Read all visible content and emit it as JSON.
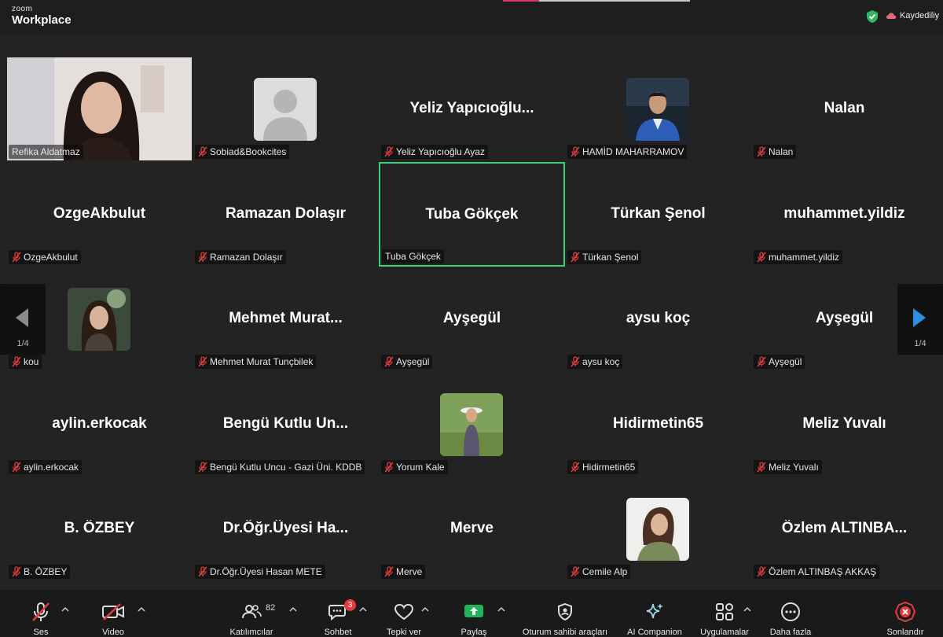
{
  "app": {
    "brand_small": "zoom",
    "brand_large": "Workplace",
    "recording_text": "Kaydediliy"
  },
  "pager": {
    "left_page": "1/4",
    "right_page": "1/4"
  },
  "tiles": [
    {
      "label": "Refika Aldatmaz",
      "big": "",
      "kind": "video",
      "muted": false
    },
    {
      "label": "Sobiad&Bookcites",
      "big": "",
      "kind": "avatar",
      "muted": true
    },
    {
      "label": "Yeliz Yapıcıoğlu  Ayaz",
      "big": "Yeliz  Yapıcıoğlu...",
      "kind": "name",
      "muted": true
    },
    {
      "label": "HAMİD MAHARRAMOV",
      "big": "",
      "kind": "photo-man",
      "muted": true
    },
    {
      "label": "Nalan",
      "big": "Nalan",
      "kind": "name",
      "muted": true
    },
    {
      "label": "OzgeAkbulut",
      "big": "OzgeAkbulut",
      "kind": "name",
      "muted": true
    },
    {
      "label": "Ramazan Dolaşır",
      "big": "Ramazan Dolaşır",
      "kind": "name",
      "muted": true
    },
    {
      "label": "Tuba Gökçek",
      "big": "Tuba Gökçek",
      "kind": "name",
      "muted": false,
      "active": true
    },
    {
      "label": "Türkan Şenol",
      "big": "Türkan Şenol",
      "kind": "name",
      "muted": true
    },
    {
      "label": "muhammet.yildiz",
      "big": "muhammet.yildiz",
      "kind": "name",
      "muted": true
    },
    {
      "label": "kou",
      "big": "",
      "kind": "photo-woman1",
      "muted": true
    },
    {
      "label": "Mehmet Murat Tunçbilek",
      "big": "Mehmet  Murat...",
      "kind": "name",
      "muted": true
    },
    {
      "label": "Ayşegül",
      "big": "Ayşegül",
      "kind": "name",
      "muted": true
    },
    {
      "label": "aysu koç",
      "big": "aysu koç",
      "kind": "name",
      "muted": true
    },
    {
      "label": "Ayşegül",
      "big": "Ayşegül",
      "kind": "name",
      "muted": true
    },
    {
      "label": "aylin.erkocak",
      "big": "aylin.erkocak",
      "kind": "name",
      "muted": true
    },
    {
      "label": "Bengü Kutlu Uncu - Gazi Üni. KDDB",
      "big": "Bengü  Kutlu  Un...",
      "kind": "name",
      "muted": true
    },
    {
      "label": "Yorum Kale",
      "big": "",
      "kind": "photo-woman2",
      "muted": true
    },
    {
      "label": "Hidirmetin65",
      "big": "Hidirmetin65",
      "kind": "name",
      "muted": true
    },
    {
      "label": "Meliz Yuvalı",
      "big": "Meliz Yuvalı",
      "kind": "name",
      "muted": true
    },
    {
      "label": "B. ÖZBEY",
      "big": "B. ÖZBEY",
      "kind": "name",
      "muted": true
    },
    {
      "label": "Dr.Öğr.Üyesi Hasan METE",
      "big": "Dr.Öğr.Üyesi  Ha...",
      "kind": "name",
      "muted": true
    },
    {
      "label": "Merve",
      "big": "Merve",
      "kind": "name",
      "muted": true
    },
    {
      "label": "Cemile Alp",
      "big": "",
      "kind": "photo-woman3",
      "muted": true
    },
    {
      "label": "Özlem ALTINBAŞ AKKAŞ",
      "big": "Özlem  ALTINBA...",
      "kind": "name",
      "muted": true
    }
  ],
  "toolbar": {
    "audio": "Ses",
    "video": "Video",
    "participants": "Katılımcılar",
    "participants_count": "82",
    "chat": "Sohbet",
    "chat_badge": "3",
    "react": "Tepki ver",
    "share": "Paylaş",
    "host_tools": "Oturum sahibi araçları",
    "ai": "AI Companion",
    "apps": "Uygulamalar",
    "more": "Daha fazla",
    "end": "Sonlandır"
  }
}
